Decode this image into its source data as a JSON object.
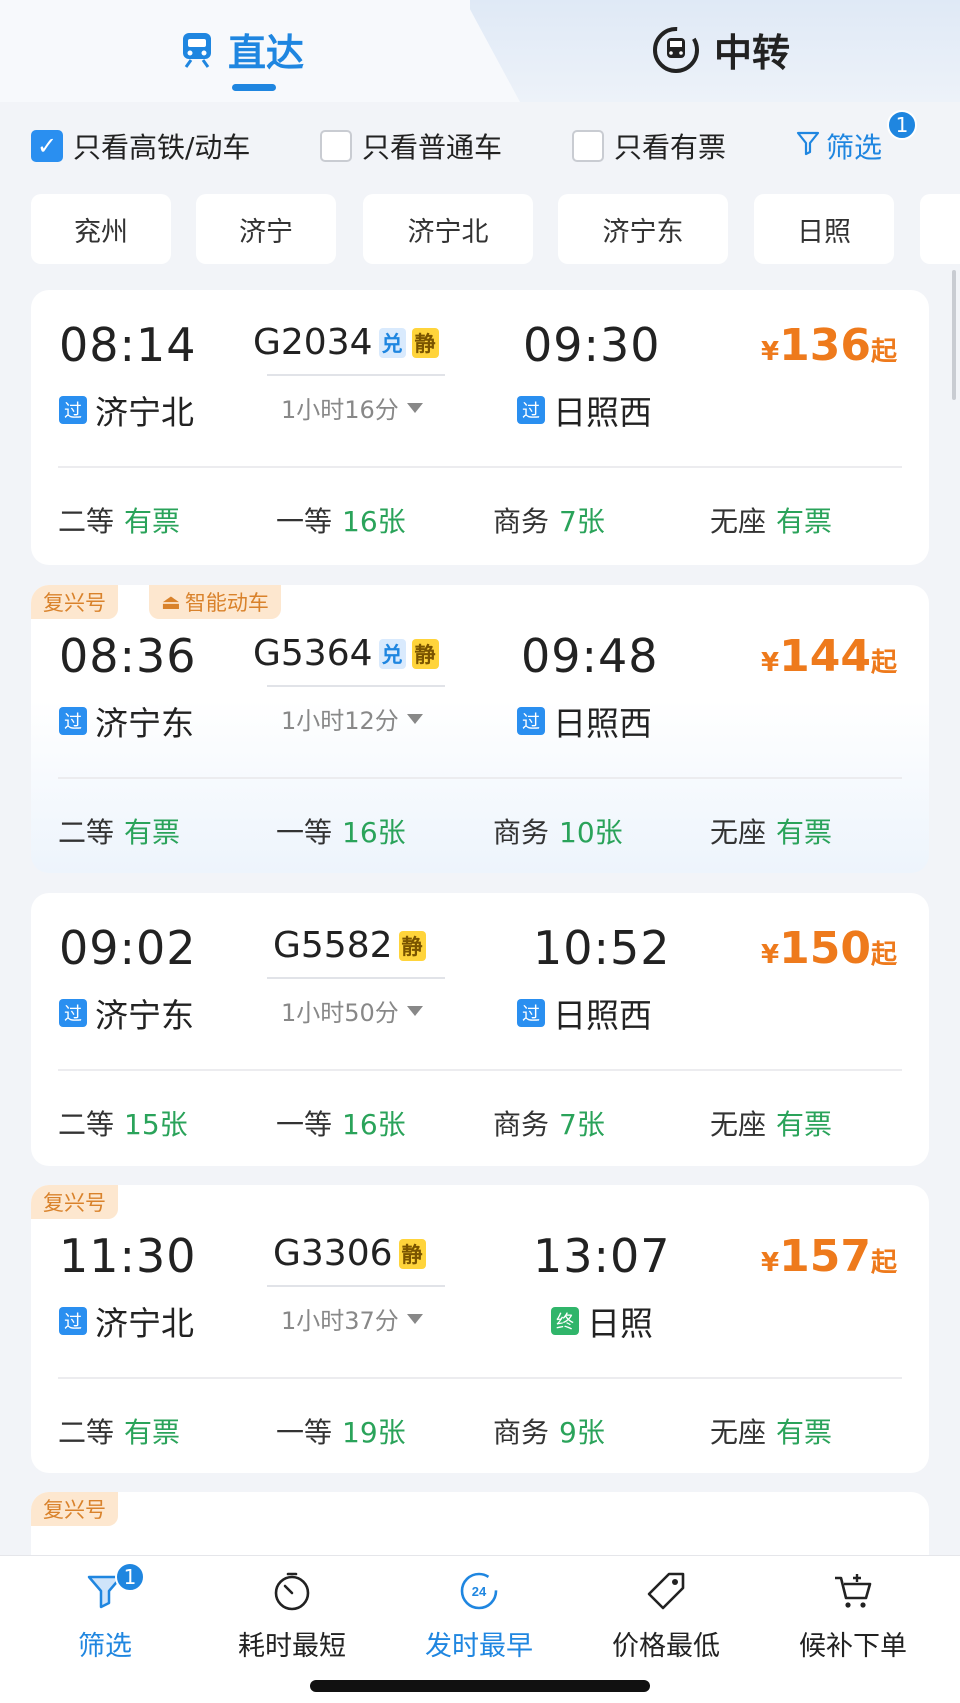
{
  "tabs": [
    {
      "label": "直达"
    },
    {
      "label": "中转"
    }
  ],
  "filters": {
    "checkboxes": [
      {
        "label": "只看高铁/动车",
        "checked": true
      },
      {
        "label": "只看普通车",
        "checked": false
      },
      {
        "label": "只看有票",
        "checked": false
      }
    ],
    "filter_link": "筛选",
    "filter_count": "1"
  },
  "stations": [
    "兖州",
    "济宁",
    "济宁北",
    "济宁东",
    "日照"
  ],
  "trains": [
    {
      "tags": [],
      "dep_time": "08:14",
      "dep_station": "济宁北",
      "dep_badge": "过",
      "train_no": "G2034",
      "marks": [
        "兑",
        "静"
      ],
      "duration": "1小时16分",
      "arr_time": "09:30",
      "arr_station": "日照西",
      "arr_badge": "过",
      "currency": "¥",
      "price": "136",
      "price_suffix": "起",
      "seats": [
        {
          "name": "二等",
          "value": "有票"
        },
        {
          "name": "一等",
          "value": "16张"
        },
        {
          "name": "商务",
          "value": "7张"
        },
        {
          "name": "无座",
          "value": "有票"
        }
      ]
    },
    {
      "tags": [
        "复兴号",
        "智能动车"
      ],
      "dep_time": "08:36",
      "dep_station": "济宁东",
      "dep_badge": "过",
      "train_no": "G5364",
      "marks": [
        "兑",
        "静"
      ],
      "duration": "1小时12分",
      "arr_time": "09:48",
      "arr_station": "日照西",
      "arr_badge": "过",
      "currency": "¥",
      "price": "144",
      "price_suffix": "起",
      "seats": [
        {
          "name": "二等",
          "value": "有票"
        },
        {
          "name": "一等",
          "value": "16张"
        },
        {
          "name": "商务",
          "value": "10张"
        },
        {
          "name": "无座",
          "value": "有票"
        }
      ]
    },
    {
      "tags": [],
      "dep_time": "09:02",
      "dep_station": "济宁东",
      "dep_badge": "过",
      "train_no": "G5582",
      "marks": [
        "静"
      ],
      "duration": "1小时50分",
      "arr_time": "10:52",
      "arr_station": "日照西",
      "arr_badge": "过",
      "currency": "¥",
      "price": "150",
      "price_suffix": "起",
      "seats": [
        {
          "name": "二等",
          "value": "15张"
        },
        {
          "name": "一等",
          "value": "16张"
        },
        {
          "name": "商务",
          "value": "7张"
        },
        {
          "name": "无座",
          "value": "有票"
        }
      ]
    },
    {
      "tags": [
        "复兴号"
      ],
      "dep_time": "11:30",
      "dep_station": "济宁北",
      "dep_badge": "过",
      "train_no": "G3306",
      "marks": [
        "静"
      ],
      "duration": "1小时37分",
      "arr_time": "13:07",
      "arr_station": "日照",
      "arr_badge": "终",
      "currency": "¥",
      "price": "157",
      "price_suffix": "起",
      "seats": [
        {
          "name": "二等",
          "value": "有票"
        },
        {
          "name": "一等",
          "value": "19张"
        },
        {
          "name": "商务",
          "value": "9张"
        },
        {
          "name": "无座",
          "value": "有票"
        }
      ]
    }
  ],
  "partial_card": {
    "tag": "复兴号"
  },
  "bottom_nav": [
    {
      "label": "筛选",
      "icon": "filter-icon",
      "badge": "1",
      "active": true
    },
    {
      "label": "耗时最短",
      "icon": "timer-icon",
      "active": false
    },
    {
      "label": "发时最早",
      "icon": "clock-24-icon",
      "icon_text": "24",
      "active": true
    },
    {
      "label": "价格最低",
      "icon": "price-tag-icon",
      "active": false
    },
    {
      "label": "候补下单",
      "icon": "cart-icon",
      "active": false
    }
  ],
  "colors": {
    "accent": "#1f86e0",
    "price": "#ee7a1c",
    "available": "#2aa35a",
    "tag_bg": "#fde7cf"
  }
}
